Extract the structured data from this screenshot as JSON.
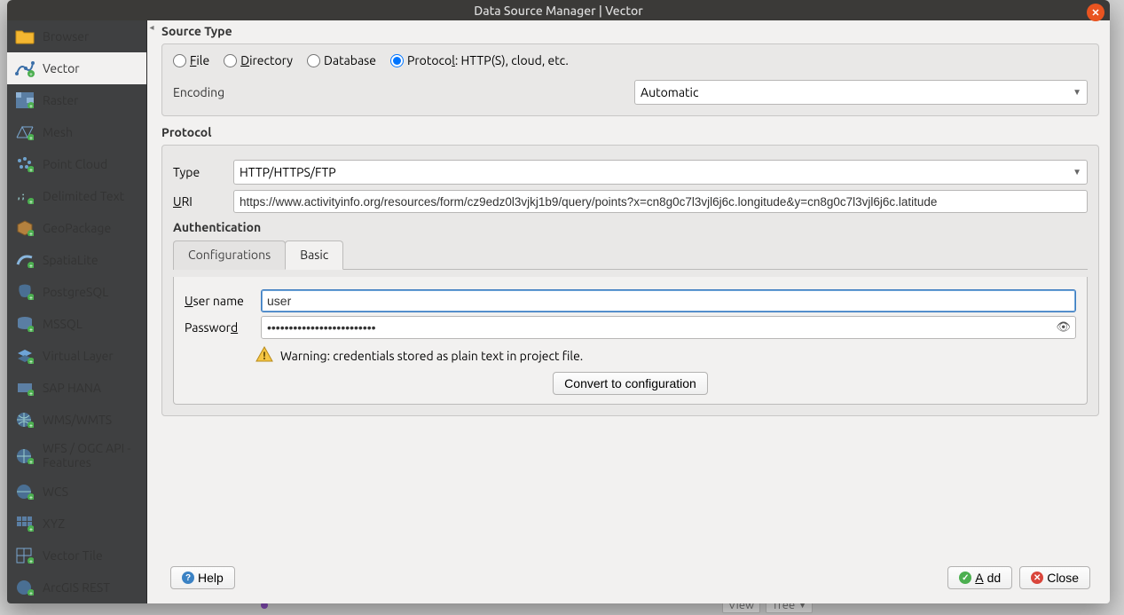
{
  "window": {
    "title": "Data Source Manager | Vector"
  },
  "sidebar": [
    {
      "label": "Browser",
      "icon": "folder"
    },
    {
      "label": "Vector",
      "icon": "vector",
      "active": true
    },
    {
      "label": "Raster",
      "icon": "raster"
    },
    {
      "label": "Mesh",
      "icon": "mesh"
    },
    {
      "label": "Point Cloud",
      "icon": "pointcloud"
    },
    {
      "label": "Delimited Text",
      "icon": "csv"
    },
    {
      "label": "GeoPackage",
      "icon": "gpkg"
    },
    {
      "label": "SpatiaLite",
      "icon": "feather"
    },
    {
      "label": "PostgreSQL",
      "icon": "pg"
    },
    {
      "label": "MSSQL",
      "icon": "mssql"
    },
    {
      "label": "Virtual Layer",
      "icon": "virtual"
    },
    {
      "label": "SAP HANA",
      "icon": "hana"
    },
    {
      "label": "WMS/WMTS",
      "icon": "globe"
    },
    {
      "label": "WFS / OGC API - Features",
      "icon": "globe"
    },
    {
      "label": "WCS",
      "icon": "globe"
    },
    {
      "label": "XYZ",
      "icon": "grid"
    },
    {
      "label": "Vector Tile",
      "icon": "vtile"
    },
    {
      "label": "ArcGIS REST",
      "icon": "globe"
    }
  ],
  "source_type": {
    "title": "Source Type",
    "options": {
      "file": "File",
      "directory": "Directory",
      "database": "Database",
      "protocol": "Protocol: HTTP(S), cloud, etc."
    },
    "selected": "protocol",
    "encoding_label": "Encoding",
    "encoding_value": "Automatic"
  },
  "protocol": {
    "title": "Protocol",
    "type_label": "Type",
    "type_value": "HTTP/HTTPS/FTP",
    "uri_label": "URI",
    "uri_value": "https://www.activityinfo.org/resources/form/cz9edz0l3vjkj1b9/query/points?x=cn8g0c7l3vjl6j6c.longitude&y=cn8g0c7l3vjl6j6c.latitude"
  },
  "auth": {
    "title": "Authentication",
    "tabs": {
      "configurations": "Configurations",
      "basic": "Basic",
      "active": "basic"
    },
    "username_label": "User name",
    "username_value": "user",
    "password_label": "Password",
    "password_value": "•••••••••••••••••••••••••",
    "warning": "Warning: credentials stored as plain text in project file.",
    "convert_btn": "Convert to configuration"
  },
  "footer": {
    "help": "Help",
    "add": "Add",
    "close": "Close"
  },
  "statusbar": {
    "view": "View",
    "tree": "Tree"
  }
}
